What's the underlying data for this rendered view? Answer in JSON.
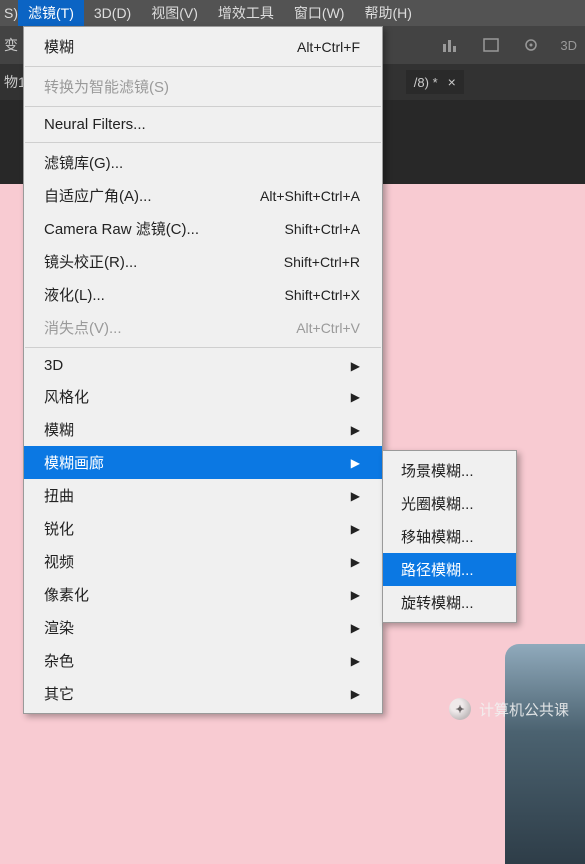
{
  "menubar": {
    "items": [
      {
        "label": "滤镜(T)",
        "active": true
      },
      {
        "label": "3D(D)"
      },
      {
        "label": "视图(V)"
      },
      {
        "label": "增效工具"
      },
      {
        "label": "窗口(W)"
      },
      {
        "label": "帮助(H)"
      }
    ],
    "left_trunc": "S)"
  },
  "secondbar": {
    "left_trunc": "变",
    "icon_text_3d": "3D"
  },
  "thirdbar": {
    "left_trunc": "物1",
    "tab_label": "/8) *",
    "tab_close": "×"
  },
  "menu": {
    "items": [
      {
        "label": "模糊",
        "shortcut": "Alt+Ctrl+F"
      },
      {
        "sep": true
      },
      {
        "label": "转换为智能滤镜(S)",
        "disabled": true
      },
      {
        "sep": true
      },
      {
        "label": "Neural Filters..."
      },
      {
        "sep": true
      },
      {
        "label": "滤镜库(G)..."
      },
      {
        "label": "自适应广角(A)...",
        "shortcut": "Alt+Shift+Ctrl+A"
      },
      {
        "label": "Camera Raw 滤镜(C)...",
        "shortcut": "Shift+Ctrl+A"
      },
      {
        "label": "镜头校正(R)...",
        "shortcut": "Shift+Ctrl+R"
      },
      {
        "label": "液化(L)...",
        "shortcut": "Shift+Ctrl+X"
      },
      {
        "label": "消失点(V)...",
        "shortcut": "Alt+Ctrl+V",
        "disabled": true
      },
      {
        "sep": true
      },
      {
        "label": "3D",
        "arrow": true
      },
      {
        "label": "风格化",
        "arrow": true
      },
      {
        "label": "模糊",
        "arrow": true
      },
      {
        "label": "模糊画廊",
        "arrow": true,
        "highlight": true
      },
      {
        "label": "扭曲",
        "arrow": true
      },
      {
        "label": "锐化",
        "arrow": true
      },
      {
        "label": "视频",
        "arrow": true
      },
      {
        "label": "像素化",
        "arrow": true
      },
      {
        "label": "渲染",
        "arrow": true
      },
      {
        "label": "杂色",
        "arrow": true
      },
      {
        "label": "其它",
        "arrow": true
      }
    ]
  },
  "submenu": {
    "items": [
      {
        "label": "场景模糊..."
      },
      {
        "label": "光圈模糊..."
      },
      {
        "label": "移轴模糊..."
      },
      {
        "label": "路径模糊...",
        "highlight": true
      },
      {
        "label": "旋转模糊..."
      }
    ]
  },
  "watermark": {
    "text": "计算机公共课"
  }
}
